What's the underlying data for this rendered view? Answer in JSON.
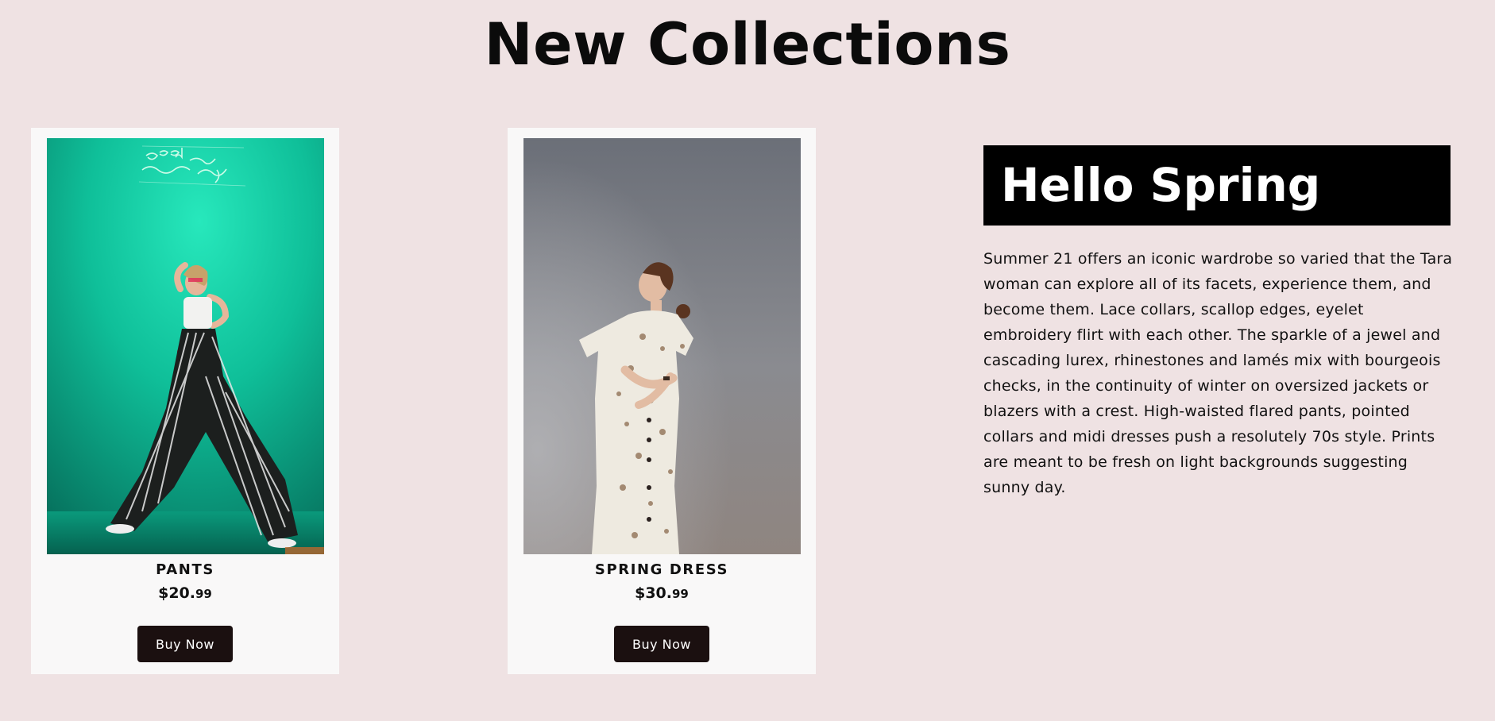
{
  "page": {
    "title": "New Collections",
    "background": "#efe2e3"
  },
  "products": [
    {
      "name": "PANTS",
      "price_main": "$20.",
      "price_cents": "99",
      "button_label": "Buy Now",
      "image_alt": "Model in striped wide-leg pants against a teal wall with neon sign"
    },
    {
      "name": "SPRING DRESS",
      "price_main": "$30.",
      "price_cents": "99",
      "button_label": "Buy Now",
      "image_alt": "Model in a white floral jumpsuit against a grey sky"
    }
  ],
  "promo": {
    "heading": "Hello Spring",
    "body": "Summer 21 offers an iconic wardrobe so varied that the Tara woman can explore all of its facets, experience them, and become them. Lace collars, scallop edges, eyelet embroidery flirt with each other. The sparkle of a jewel and cascading lurex, rhinestones and lamés mix with bourgeois checks, in the continuity of winter on oversized jackets or blazers with a crest. High-waisted flared pants, pointed collars and midi dresses push a resolutely 70s style. Prints are meant to be fresh on light backgrounds suggesting sunny day."
  },
  "colors": {
    "button": "#1b1010",
    "card": "#f9f8f8",
    "banner": "#000000"
  }
}
